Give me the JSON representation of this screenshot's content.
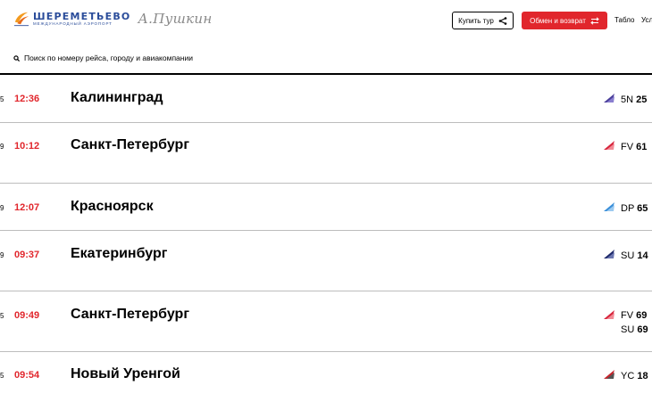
{
  "header": {
    "logo_name": "ШЕРЕМЕТЬЕВО",
    "logo_sub": "МЕЖДУНАРОДНЫЙ АЭРОПОРТ",
    "logo_signature": "А.Пушкин",
    "buy_tour_label": "Купить тур",
    "exchange_label": "Обмен и возврат",
    "nav": [
      "Табло",
      "Усл"
    ]
  },
  "search": {
    "placeholder": "Поиск по номеру рейса, городу и авиакомпании"
  },
  "flights": [
    {
      "edge": "5",
      "time": "12:36",
      "city": "Калининград",
      "codes": [
        {
          "carrier": "5N",
          "number": "25"
        }
      ],
      "logo_color": "#4a3f9a"
    },
    {
      "edge": "9",
      "time": "10:12",
      "city": "Санкт-Петербург",
      "codes": [
        {
          "carrier": "FV",
          "number": "61"
        }
      ],
      "logo_color": "#d7263d"
    },
    {
      "edge": "9",
      "time": "12:07",
      "city": "Красноярск",
      "codes": [
        {
          "carrier": "DP",
          "number": "65"
        }
      ],
      "logo_color": "#3a8fd9"
    },
    {
      "edge": "9",
      "time": "09:37",
      "city": "Екатеринбург",
      "codes": [
        {
          "carrier": "SU",
          "number": "14"
        }
      ],
      "logo_color": "#1f2a6b"
    },
    {
      "edge": "5",
      "time": "09:49",
      "city": "Санкт-Петербург",
      "codes": [
        {
          "carrier": "FV",
          "number": "69"
        },
        {
          "carrier": "SU",
          "number": "69"
        }
      ],
      "logo_color": "#d7263d"
    },
    {
      "edge": "5",
      "time": "09:54",
      "city": "Новый Уренгой",
      "codes": [
        {
          "carrier": "YC",
          "number": "18"
        }
      ],
      "logo_color": "#c4262e"
    }
  ]
}
